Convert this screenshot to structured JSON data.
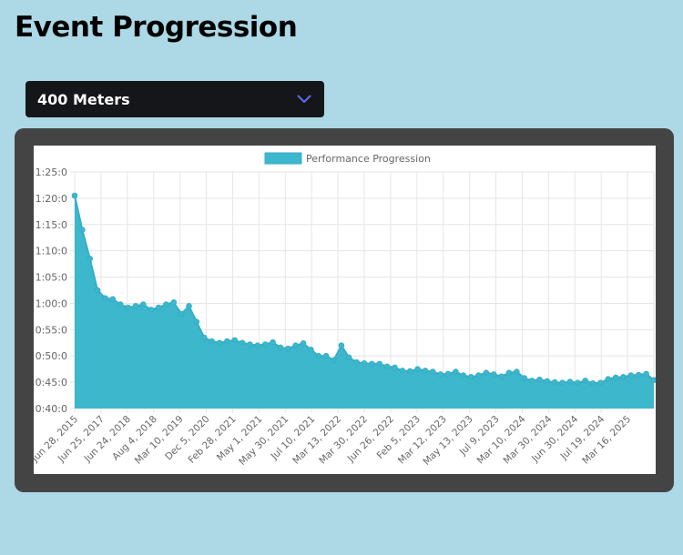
{
  "page": {
    "title": "Event Progression"
  },
  "event_select": {
    "value": "400 Meters"
  },
  "colors": {
    "fill": "#3db7cc",
    "line": "#36aec6",
    "grid": "#e6e6e6",
    "text": "#666666"
  },
  "chart_data": {
    "type": "area",
    "legend": {
      "label": "Performance Progression",
      "position": "top"
    },
    "yaxis": {
      "unit": "seconds",
      "min": 40,
      "max": 85,
      "step": 5,
      "tick_labels": [
        "0:40:0",
        "0:45:0",
        "0:50:0",
        "0:55:0",
        "1:00:0",
        "1:05:0",
        "1:10:0",
        "1:15:0",
        "1:20:0",
        "1:25:0"
      ]
    },
    "xaxis": {
      "tick_labels": [
        "Jun 28, 2015",
        "Jun 25, 2017",
        "Jun 24, 2018",
        "Aug 4, 2018",
        "Mar 10, 2019",
        "Dec 5, 2020",
        "Feb 28, 2021",
        "May 1, 2021",
        "May 30, 2021",
        "Jul 10, 2021",
        "Mar 13, 2022",
        "Mar 30, 2022",
        "Jun 26, 2022",
        "Feb 5, 2023",
        "Mar 12, 2023",
        "May 13, 2023",
        "Jul 9, 2023",
        "Mar 10, 2024",
        "Mar 30, 2024",
        "Jun 30, 2024",
        "Jul 19, 2024",
        "Mar 16, 2025"
      ]
    },
    "grid": true,
    "values": [
      80.5,
      74.0,
      68.5,
      62.5,
      61.0,
      60.8,
      59.8,
      59.2,
      59.5,
      59.8,
      58.8,
      59.2,
      59.8,
      60.2,
      58.0,
      59.5,
      56.5,
      53.5,
      52.8,
      52.5,
      52.8,
      53.0,
      52.5,
      52.2,
      52.0,
      52.2,
      52.6,
      51.6,
      51.4,
      52.0,
      52.4,
      51.2,
      50.0,
      50.0,
      49.2,
      52.0,
      49.7,
      48.8,
      48.6,
      48.5,
      48.5,
      48.0,
      47.8,
      47.2,
      47.1,
      47.5,
      47.2,
      47.0,
      46.5,
      46.6,
      47.0,
      46.3,
      46.0,
      46.3,
      46.8,
      46.5,
      46.1,
      46.8,
      47.0,
      45.8,
      45.3,
      45.5,
      45.2,
      45.0,
      44.9,
      45.1,
      44.9,
      45.3,
      44.8,
      44.9,
      45.6,
      45.9,
      46.0,
      46.3,
      46.4,
      46.6,
      45.4
    ]
  }
}
